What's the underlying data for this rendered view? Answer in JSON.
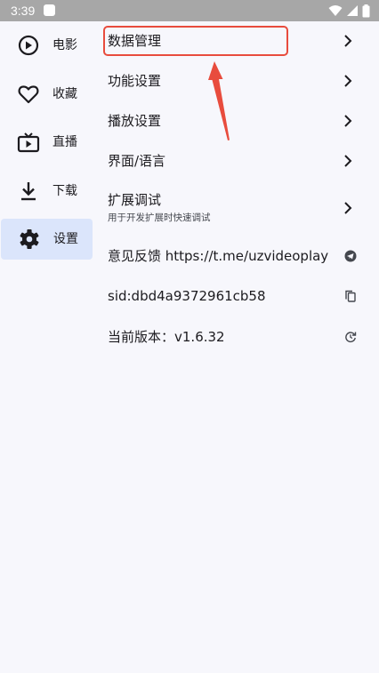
{
  "status_bar": {
    "time": "3:39"
  },
  "rail": {
    "items": [
      {
        "label": "电影",
        "icon": "play-circle-icon"
      },
      {
        "label": "收藏",
        "icon": "heart-icon"
      },
      {
        "label": "直播",
        "icon": "tv-icon"
      },
      {
        "label": "下载",
        "icon": "download-icon"
      },
      {
        "label": "设置",
        "icon": "gear-icon",
        "selected": true
      }
    ]
  },
  "settings": {
    "data_management": "数据管理",
    "function_settings": "功能设置",
    "playback_settings": "播放设置",
    "ui_language": "界面/语言",
    "extension_debug": {
      "title": "扩展调试",
      "subtitle": "用于开发扩展时快速调试"
    },
    "feedback": "意见反馈 https://t.me/uzvideoplay",
    "sid": "sid:dbd4a9372961cb58",
    "version": "当前版本：v1.6.32"
  },
  "colors": {
    "accent_selected": "#dbe5fb",
    "annotation": "#e84c3d",
    "background": "#f7f7fc"
  }
}
